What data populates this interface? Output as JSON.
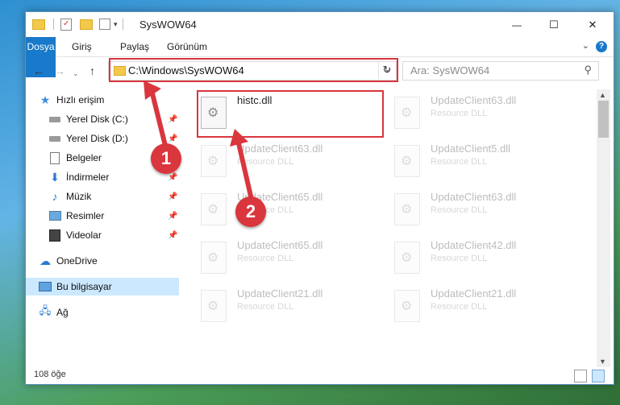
{
  "window": {
    "title": "SysWOW64",
    "controls": {
      "minimize": "—",
      "maximize": "☐",
      "close": "✕"
    }
  },
  "ribbon": {
    "tabs": [
      "Dosya",
      "Giriş",
      "Paylaş",
      "Görünüm"
    ],
    "help": "?"
  },
  "nav": {
    "address": "C:\\Windows\\SysWOW64",
    "search_placeholder": "Ara: SysWOW64"
  },
  "sidebar": {
    "items": [
      {
        "label": "Hızlı erişim",
        "icon": "star-icon",
        "pinned": false
      },
      {
        "label": "Yerel Disk (C:)",
        "icon": "drive-icon",
        "pinned": true
      },
      {
        "label": "Yerel Disk (D:)",
        "icon": "drive-icon",
        "pinned": true
      },
      {
        "label": "Belgeler",
        "icon": "document-icon",
        "pinned": true
      },
      {
        "label": "İndirmeler",
        "icon": "download-icon",
        "pinned": true
      },
      {
        "label": "Müzik",
        "icon": "music-icon",
        "pinned": true
      },
      {
        "label": "Resimler",
        "icon": "picture-icon",
        "pinned": true
      },
      {
        "label": "Videolar",
        "icon": "video-icon",
        "pinned": true
      },
      {
        "label": "OneDrive",
        "icon": "cloud-icon",
        "pinned": false
      },
      {
        "label": "Bu bilgisayar",
        "icon": "computer-icon",
        "pinned": false,
        "selected": true
      },
      {
        "label": "Ağ",
        "icon": "network-icon",
        "pinned": false
      }
    ]
  },
  "files": [
    {
      "name": "histc.dll",
      "desc": "",
      "highlighted": true
    },
    {
      "name": "UpdateClient63.dll",
      "desc": "Resource DLL"
    },
    {
      "name": "UpdateClient63.dll",
      "desc": "Resource DLL"
    },
    {
      "name": "UpdateClient5.dll",
      "desc": "Resource DLL"
    },
    {
      "name": "UpdateClient65.dll",
      "desc": "Resource DLL"
    },
    {
      "name": "UpdateClient63.dll",
      "desc": "Resource DLL"
    },
    {
      "name": "UpdateClient65.dll",
      "desc": "Resource DLL"
    },
    {
      "name": "UpdateClient42.dll",
      "desc": "Resource DLL"
    },
    {
      "name": "UpdateClient21.dll",
      "desc": "Resource DLL"
    },
    {
      "name": "UpdateClient21.dll",
      "desc": "Resource DLL"
    }
  ],
  "status": {
    "item_count": "108 öğe"
  },
  "annotations": {
    "step1": "1",
    "step2": "2"
  },
  "colors": {
    "accent": "#1979ca",
    "annotation": "#d9363e",
    "selection": "#cce8ff"
  }
}
